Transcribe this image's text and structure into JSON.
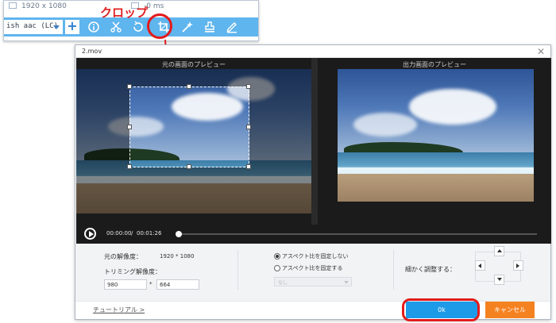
{
  "annotation": {
    "crop_label": "クロップ"
  },
  "toolbar": {
    "resolution_left": "1920 x 1080",
    "resolution_right": "-0 ms",
    "audio_track": "ish aac (LC)",
    "add_label": "+",
    "tools": [
      "info-icon",
      "scissors-icon",
      "rotate-icon",
      "crop-icon",
      "effects-icon",
      "watermark-icon",
      "edit-icon"
    ]
  },
  "dialog": {
    "title": "2.mov",
    "close": "✕",
    "source_preview_label": "元の画面のプレビュー",
    "output_preview_label": "出力画面のプレビュー",
    "time_current": "00:00:00",
    "time_separator": "/",
    "time_total": "00:01:26",
    "progress": 0.0,
    "settings": {
      "original_res_label": "元の解像度：",
      "original_res_value": "1920 * 1080",
      "trim_res_label": "トリミング解像度：",
      "width_value": "980",
      "multiply_sign": "*",
      "height_value": "664",
      "aspect_free_label": "アスペクト比を固定しない",
      "aspect_fixed_label": "アスペクト比を固定する",
      "aspect_selected": "free",
      "ratio_placeholder": "なし",
      "fine_adjust_label": "細かく調整する："
    },
    "footer": {
      "tutorial_label": "チュートリアル >",
      "ok_label": "0k",
      "cancel_label": "キャンセル"
    }
  },
  "colors": {
    "toolbar_blue": "#5fb5ee",
    "ok_blue": "#1e9be8",
    "cancel_orange": "#f58220",
    "annotation_red": "#e31b1b"
  }
}
